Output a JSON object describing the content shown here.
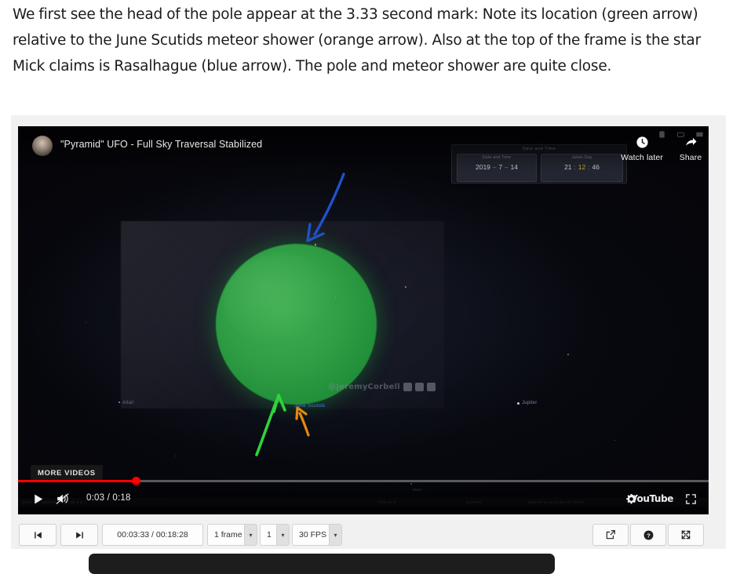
{
  "caption": {
    "text": "We first see the head of the pole appear at the 3.33 second mark: Note its location (green arrow) relative to the June Scutids meteor shower (orange arrow). Also at the top of the frame is the star Mick claims is Rasalhague (blue arrow). The pole and meteor shower are quite close."
  },
  "player": {
    "video_title": "\"Pyramid\" UFO - Full Sky Traversal Stabilized",
    "watch_later_label": "Watch later",
    "share_label": "Share",
    "more_videos_label": "MORE VIDEOS",
    "current_time": "0:03",
    "duration": "0:18",
    "time_display": "0:03 / 0:18",
    "progress_percent": 17,
    "youtube_logo": "YouTube",
    "watermark": "@JeremyCorbell",
    "social_icons": [
      "instagram-icon",
      "twitter-icon",
      "facebook-icon"
    ],
    "status_strip": {
      "location": "Earth, Wit Naiad   32 41.138 35, 0 m",
      "fov": "FOV 50.8°",
      "fps": "13.3 FPS",
      "datetime": "2019-07-14 21:12:46 UTC-07:00"
    }
  },
  "stellarium_widget": {
    "title": "Date and Time",
    "date_group_label": "Date and Time",
    "time_group_label": "Julian Day",
    "year": "2019",
    "month": "7",
    "day": "14",
    "hour": "21",
    "minute": "12",
    "second": "46",
    "date_separator": "–",
    "time_separator": ":",
    "highlight_color": "#d8a72e"
  },
  "sky_labels": [
    {
      "name": "June Scutids",
      "color": "#3f7fd0"
    },
    {
      "name": "Altair",
      "color": "#5b6f93"
    },
    {
      "name": "Jupiter",
      "color": "#6f86ad"
    }
  ],
  "annotations": [
    {
      "name": "blue-arrow",
      "target": "Rasalhague star",
      "color": "#1f52c8"
    },
    {
      "name": "green-arrow",
      "target": "head of the pole",
      "color": "#2fd43a"
    },
    {
      "name": "orange-arrow",
      "target": "June Scutids meteor shower",
      "color": "#e8890f"
    }
  ],
  "toolbar": {
    "prev_frame_icon": "step-backward-icon",
    "next_frame_icon": "step-forward-icon",
    "timecode": "00:03:33 / 00:18:28",
    "step_size": "1 frame",
    "step_count": "1",
    "frame_rate": "30 FPS",
    "share_icon": "external-link-icon",
    "help_icon": "help-circle-icon",
    "expand_icon": "expand-icon"
  }
}
